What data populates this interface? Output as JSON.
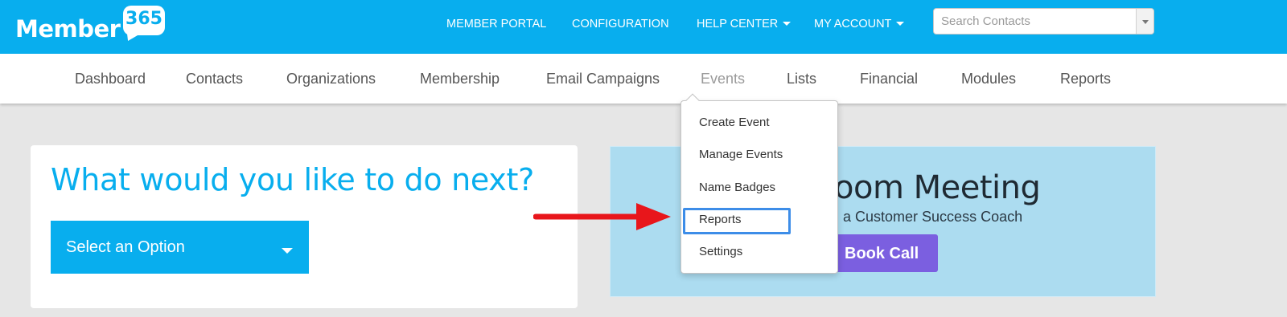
{
  "brand": {
    "logo_text": "Member",
    "logo_number": "365"
  },
  "top_nav": {
    "items": [
      {
        "label": "MEMBER PORTAL",
        "has_caret": false
      },
      {
        "label": "CONFIGURATION",
        "has_caret": false
      },
      {
        "label": "HELP CENTER",
        "has_caret": true
      },
      {
        "label": "MY ACCOUNT",
        "has_caret": true
      }
    ]
  },
  "search": {
    "placeholder": "Search Contacts",
    "value": ""
  },
  "main_nav": {
    "items": [
      {
        "label": "Dashboard"
      },
      {
        "label": "Contacts"
      },
      {
        "label": "Organizations"
      },
      {
        "label": "Membership"
      },
      {
        "label": "Email Campaigns"
      },
      {
        "label": "Events",
        "active": true
      },
      {
        "label": "Lists"
      },
      {
        "label": "Financial"
      },
      {
        "label": "Modules"
      },
      {
        "label": "Reports"
      }
    ]
  },
  "events_menu": {
    "items": [
      {
        "label": "Create Event"
      },
      {
        "label": "Manage Events"
      },
      {
        "label": "Name Badges"
      },
      {
        "label": "Reports",
        "highlighted": true
      },
      {
        "label": "Settings"
      }
    ]
  },
  "next_action": {
    "heading": "What would you like to do next?",
    "select_label": "Select an Option"
  },
  "promo": {
    "title": "oom Meeting",
    "subtitle": "n a Customer Success Coach",
    "button_label": "Book Call"
  },
  "colors": {
    "brand_blue": "#08aeee",
    "promo_bg": "#acdcf0",
    "book_button": "#7b5fe0",
    "annotation_arrow": "#e8161b",
    "highlight_box": "#3d8de8"
  },
  "icons": {
    "search_dropdown": "chevron-down-icon",
    "nav_caret": "caret-down-icon",
    "annotation": "right-arrow-icon"
  }
}
